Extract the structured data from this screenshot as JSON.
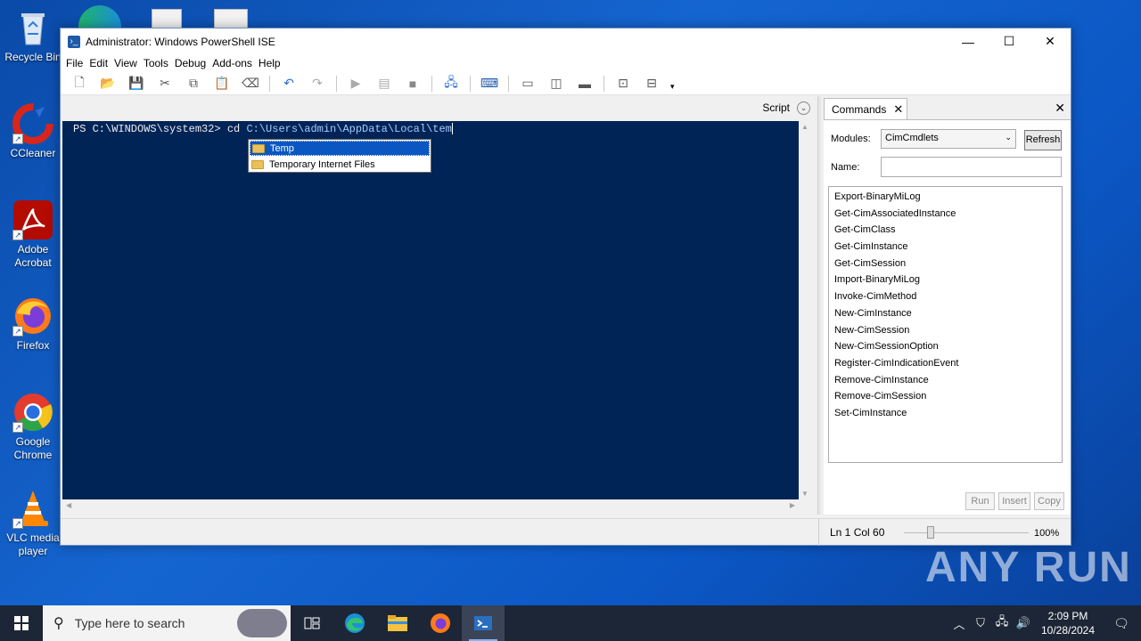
{
  "desktop": {
    "icons": [
      {
        "label": "Recycle Bin"
      },
      {
        "label": "CCleaner"
      },
      {
        "label": "Adobe Acrobat"
      },
      {
        "label": "Firefox"
      },
      {
        "label": "Google Chrome"
      },
      {
        "label": "VLC media player"
      }
    ]
  },
  "window": {
    "title": "Administrator: Windows PowerShell ISE",
    "minimize": "—",
    "maximize": "☐",
    "close": "✕"
  },
  "menu": [
    "File",
    "Edit",
    "View",
    "Tools",
    "Debug",
    "Add-ons",
    "Help"
  ],
  "script_bar": {
    "label": "Script"
  },
  "console": {
    "prompt": "PS C:\\WINDOWS\\system32> cd ",
    "argument": "C:\\Users\\admin\\AppData\\Local\\tem"
  },
  "autocomplete": [
    "Temp",
    "Temporary Internet Files"
  ],
  "commands_pane": {
    "tab_label": "Commands",
    "modules_label": "Modules:",
    "modules_value": "CimCmdlets",
    "refresh_label": "Refresh",
    "name_label": "Name:",
    "commands": [
      "Export-BinaryMiLog",
      "Get-CimAssociatedInstance",
      "Get-CimClass",
      "Get-CimInstance",
      "Get-CimSession",
      "Import-BinaryMiLog",
      "Invoke-CimMethod",
      "New-CimInstance",
      "New-CimSession",
      "New-CimSessionOption",
      "Register-CimIndicationEvent",
      "Remove-CimInstance",
      "Remove-CimSession",
      "Set-CimInstance"
    ],
    "run_label": "Run",
    "insert_label": "Insert",
    "copy_label": "Copy"
  },
  "statusbar": {
    "position": "Ln 1  Col 60",
    "zoom": "100%"
  },
  "watermark": "ANY RUN",
  "taskbar": {
    "search_placeholder": "Type here to search",
    "time": "2:09 PM",
    "date": "10/28/2024"
  },
  "colors": {
    "console_bg": "#012456",
    "console_fg": "#eeedf0",
    "desktop_bg": "#1565d0",
    "selection": "#0a57c2"
  }
}
